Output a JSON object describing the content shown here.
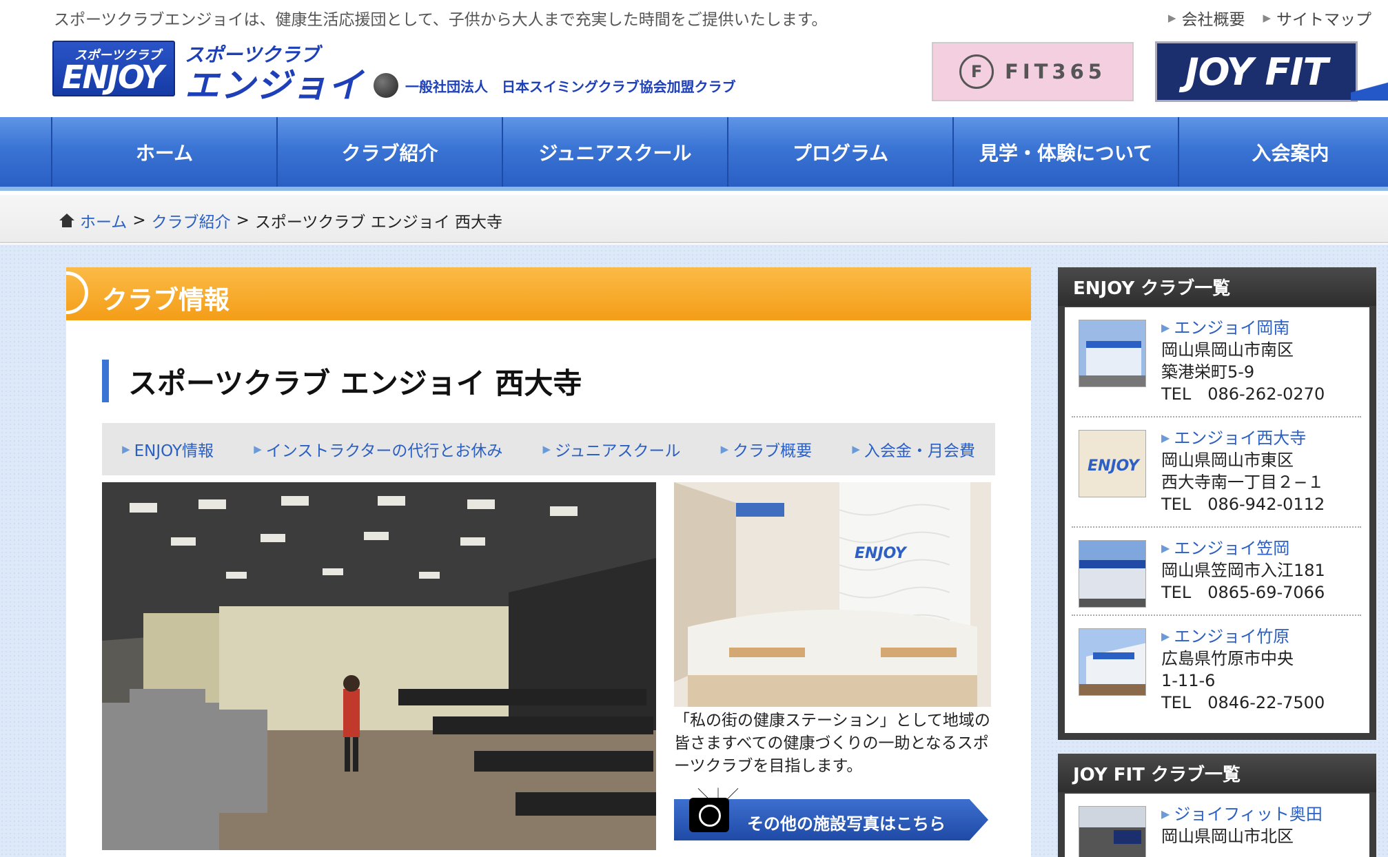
{
  "top": {
    "tagline": "スポーツクラブエンジョイは、健康生活応援団として、子供から大人まで充実した時間をご提供いたします。",
    "links": [
      "会社概要",
      "サイトマップ"
    ]
  },
  "header": {
    "logo_small": "スポーツクラブ",
    "logo_big": "ENJOY",
    "logo_text_small": "スポーツクラブ",
    "logo_text_big": "エンジョイ",
    "association": "一般社団法人　日本スイミングクラブ協会加盟クラブ",
    "fit365_label": "FIT365",
    "fit365_mark": "F",
    "joyfit_label": "JOY FIT"
  },
  "nav": [
    "ホーム",
    "クラブ紹介",
    "ジュニアスクール",
    "プログラム",
    "見学・体験について",
    "入会案内"
  ],
  "breadcrumb": {
    "home": "ホーム",
    "sep": ">",
    "club": "クラブ紹介",
    "current": "スポーツクラブ エンジョイ 西大寺"
  },
  "section_title": "クラブ情報",
  "club_title": "スポーツクラブ エンジョイ 西大寺",
  "subnav": [
    "ENJOY情報",
    "インストラクターの代行とお休み",
    "ジュニアスクール",
    "クラブ概要",
    "入会金・月会費"
  ],
  "caption": "「私の街の健康ステーション」として地域の皆さますべての健康づくりの一助となるスポーツクラブを目指します。",
  "photo_button": "その他の施設写真はこちら",
  "photo_side_logo": "ENJOY",
  "sidebar": {
    "enjoy_title": "ENJOY クラブ一覧",
    "clubs": [
      {
        "name": "エンジョイ岡南",
        "addr1": "岡山県岡山市南区",
        "addr2": "築港栄町5-9",
        "tel": "TEL　086-262-0270"
      },
      {
        "name": "エンジョイ西大寺",
        "addr1": "岡山県岡山市東区",
        "addr2": "西大寺南一丁目２−１",
        "tel": "TEL　086-942-0112"
      },
      {
        "name": "エンジョイ笠岡",
        "addr1": "岡山県笠岡市入江181",
        "tel": "TEL　0865-69-7066"
      },
      {
        "name": "エンジョイ竹原",
        "addr1": "広島県竹原市中央",
        "addr2": "1-11-6",
        "tel": "TEL　0846-22-7500"
      }
    ],
    "joyfit_title": "JOY FIT クラブ一覧",
    "joyfit_clubs": [
      {
        "name": "ジョイフィット奥田",
        "addr1": "岡山県岡山市北区"
      }
    ]
  }
}
